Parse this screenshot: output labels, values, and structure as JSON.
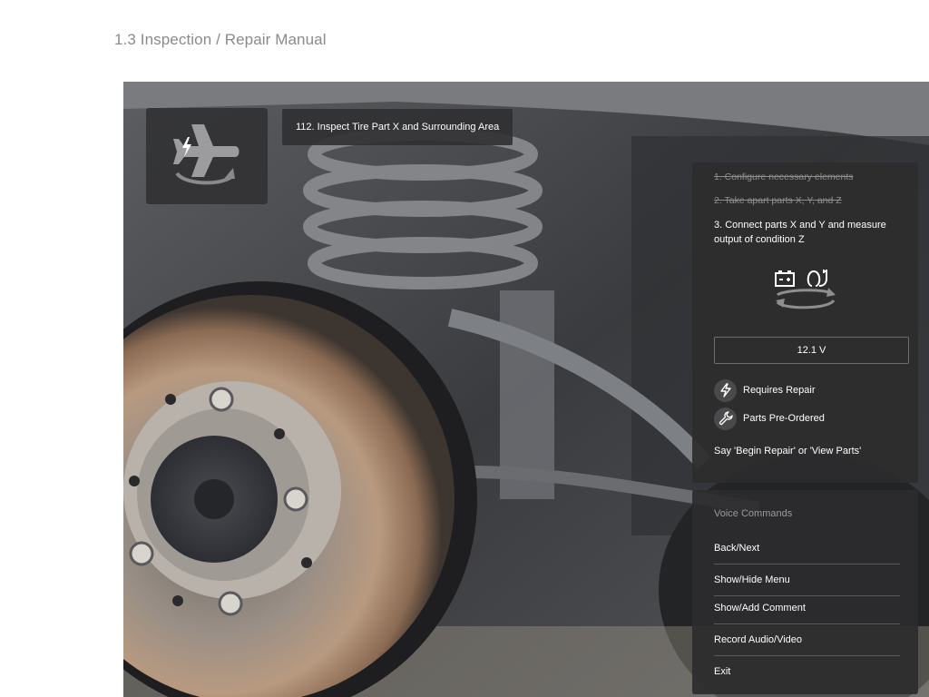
{
  "page": {
    "title": "1.3 Inspection / Repair Manual"
  },
  "hud": {
    "app_icon": "airplane-sync-icon",
    "step_title": "112. Inspect Tire Part X and Surrounding Area"
  },
  "steps_panel": {
    "completed_steps": [
      "1. Configure necessary elements",
      "2. Take apart parts X, Y, and Z"
    ],
    "current_step": "3. Connect parts X and Y and measure output of condition Z",
    "step_icon": "battery-plug-sync-icon",
    "reading": "12.1 V",
    "statuses": [
      {
        "icon": "lightning-icon",
        "label": "Requires Repair"
      },
      {
        "icon": "wrench-icon",
        "label": "Parts Pre-Ordered"
      }
    ],
    "hint": "Say 'Begin Repair' or 'View Parts'"
  },
  "voice_commands": {
    "heading": "Voice Commands",
    "items": [
      "Back/Next",
      "Show/Hide Menu",
      "Show/Add Comment",
      "Record Audio/Video",
      "Exit"
    ]
  },
  "colors": {
    "panel_bg": "#2c2c2e",
    "muted_text": "#8e8e8e",
    "title_text": "#8a8a8a"
  }
}
